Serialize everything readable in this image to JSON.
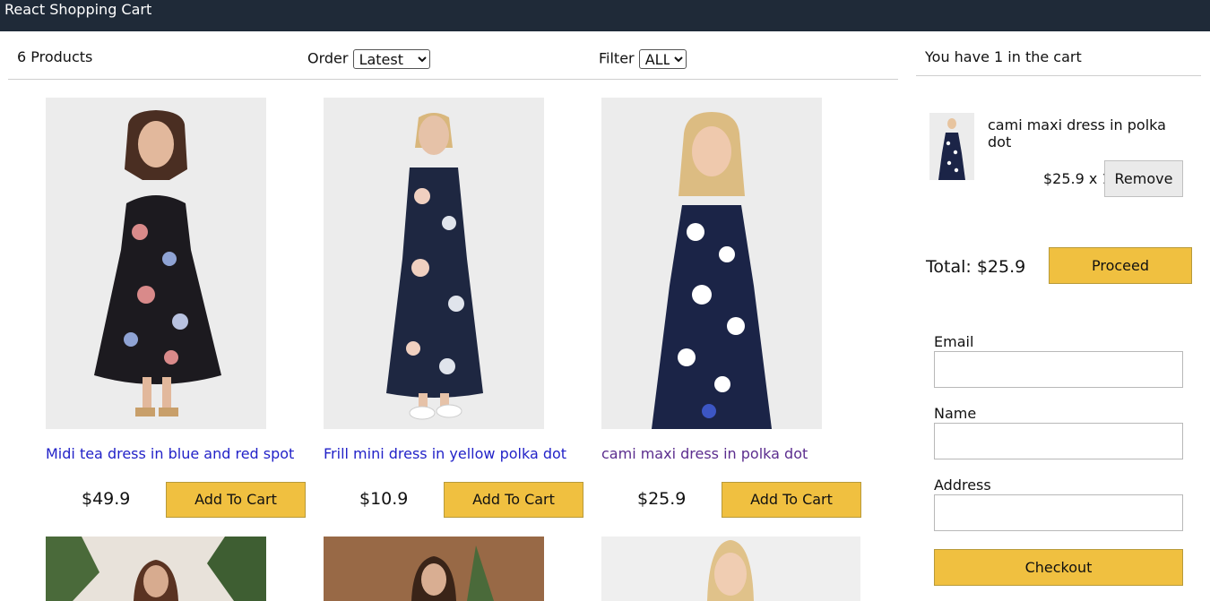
{
  "header": {
    "title": "React Shopping Cart"
  },
  "filter_bar": {
    "product_count": "6 Products",
    "order_label": "Order",
    "order_value": "Latest",
    "filter_label": "Filter",
    "filter_value": "ALL"
  },
  "products": [
    {
      "title": "Midi tea dress in blue and red spot",
      "price": "$49.9",
      "button": "Add To Cart"
    },
    {
      "title": "Frill mini dress in yellow polka dot",
      "price": "$10.9",
      "button": "Add To Cart"
    },
    {
      "title": "cami maxi dress in polka dot",
      "price": "$25.9",
      "button": "Add To Cart"
    }
  ],
  "cart": {
    "header": "You have 1 in the cart",
    "items": [
      {
        "name": "cami maxi dress in polka dot",
        "price_qty": "$25.9 x 1",
        "remove": "Remove"
      }
    ],
    "total": "Total: $25.9",
    "proceed": "Proceed",
    "form": {
      "email_label": "Email",
      "name_label": "Name",
      "address_label": "Address",
      "checkout": "Checkout"
    }
  },
  "colors": {
    "header_bg": "#1f2a38",
    "button_accent": "#f0c040",
    "link": "#2222c8",
    "visited_link": "#5b2d8e"
  }
}
